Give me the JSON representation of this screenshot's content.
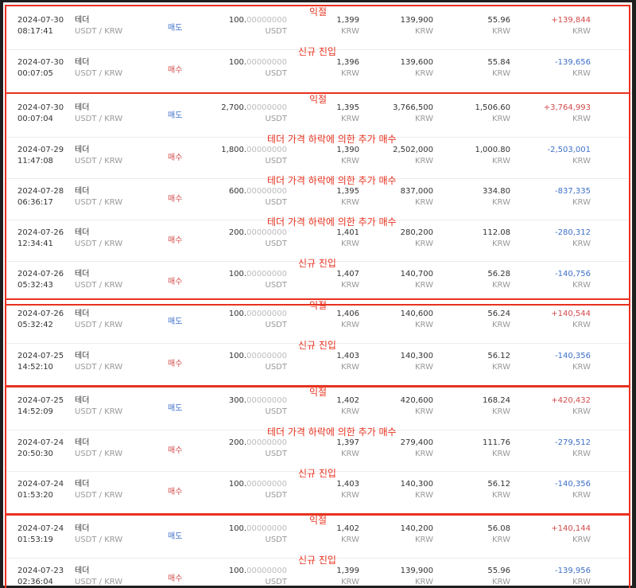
{
  "units": {
    "coin": "USDT",
    "krw": "KRW"
  },
  "colors": {
    "annotation": "#e8321f",
    "sell": "#3d6fc8",
    "buy": "#d24a4a",
    "positive": "#d24a4a",
    "negative": "#3d6fc8"
  },
  "groups": [
    {
      "trades": [
        {
          "date": "2024-07-30",
          "time": "08:17:41",
          "coin": "테더",
          "pair": "USDT / KRW",
          "side": "매도",
          "side_type": "sell",
          "qty_int": "100.",
          "qty_dec": "00000000",
          "price": "1,399",
          "total": "139,900",
          "fee": "55.96",
          "settle": "+139,844",
          "settle_sign": "pos",
          "note": "익절"
        },
        {
          "date": "2024-07-30",
          "time": "00:07:05",
          "coin": "테더",
          "pair": "USDT / KRW",
          "side": "매수",
          "side_type": "buy",
          "qty_int": "100.",
          "qty_dec": "00000000",
          "price": "1,396",
          "total": "139,600",
          "fee": "55.84",
          "settle": "-139,656",
          "settle_sign": "neg",
          "note": "신규 진입"
        }
      ]
    },
    {
      "trades": [
        {
          "date": "2024-07-30",
          "time": "00:07:04",
          "coin": "테더",
          "pair": "USDT / KRW",
          "side": "매도",
          "side_type": "sell",
          "qty_int": "2,700.",
          "qty_dec": "00000000",
          "price": "1,395",
          "total": "3,766,500",
          "fee": "1,506.60",
          "settle": "+3,764,993",
          "settle_sign": "pos",
          "note": "익절"
        },
        {
          "date": "2024-07-29",
          "time": "11:47:08",
          "coin": "테더",
          "pair": "USDT / KRW",
          "side": "매수",
          "side_type": "buy",
          "qty_int": "1,800.",
          "qty_dec": "00000000",
          "price": "1,390",
          "total": "2,502,000",
          "fee": "1,000.80",
          "settle": "-2,503,001",
          "settle_sign": "neg",
          "note": "테더 가격 하락에 의한 추가 매수"
        },
        {
          "date": "2024-07-28",
          "time": "06:36:17",
          "coin": "테더",
          "pair": "USDT / KRW",
          "side": "매수",
          "side_type": "buy",
          "qty_int": "600.",
          "qty_dec": "00000000",
          "price": "1,395",
          "total": "837,000",
          "fee": "334.80",
          "settle": "-837,335",
          "settle_sign": "neg",
          "note": "테더 가격 하락에 의한 추가 매수"
        },
        {
          "date": "2024-07-26",
          "time": "12:34:41",
          "coin": "테더",
          "pair": "USDT / KRW",
          "side": "매수",
          "side_type": "buy",
          "qty_int": "200.",
          "qty_dec": "00000000",
          "price": "1,401",
          "total": "280,200",
          "fee": "112.08",
          "settle": "-280,312",
          "settle_sign": "neg",
          "note": "테더 가격 하락에 의한 추가 매수"
        },
        {
          "date": "2024-07-26",
          "time": "05:32:43",
          "coin": "테더",
          "pair": "USDT / KRW",
          "side": "매수",
          "side_type": "buy",
          "qty_int": "100.",
          "qty_dec": "00000000",
          "price": "1,407",
          "total": "140,700",
          "fee": "56.28",
          "settle": "-140,756",
          "settle_sign": "neg",
          "note": "신규 진입"
        }
      ]
    },
    {
      "trades": [
        {
          "date": "2024-07-26",
          "time": "05:32:42",
          "coin": "테더",
          "pair": "USDT / KRW",
          "side": "매도",
          "side_type": "sell",
          "qty_int": "100.",
          "qty_dec": "00000000",
          "price": "1,406",
          "total": "140,600",
          "fee": "56.24",
          "settle": "+140,544",
          "settle_sign": "pos",
          "note": "익절"
        },
        {
          "date": "2024-07-25",
          "time": "14:52:10",
          "coin": "테더",
          "pair": "USDT / KRW",
          "side": "매수",
          "side_type": "buy",
          "qty_int": "100.",
          "qty_dec": "00000000",
          "price": "1,403",
          "total": "140,300",
          "fee": "56.12",
          "settle": "-140,356",
          "settle_sign": "neg",
          "note": "신규 진입"
        }
      ]
    },
    {
      "trades": [
        {
          "date": "2024-07-25",
          "time": "14:52:09",
          "coin": "테더",
          "pair": "USDT / KRW",
          "side": "매도",
          "side_type": "sell",
          "qty_int": "300.",
          "qty_dec": "00000000",
          "price": "1,402",
          "total": "420,600",
          "fee": "168.24",
          "settle": "+420,432",
          "settle_sign": "pos",
          "note": "익절"
        },
        {
          "date": "2024-07-24",
          "time": "20:50:30",
          "coin": "테더",
          "pair": "USDT / KRW",
          "side": "매수",
          "side_type": "buy",
          "qty_int": "200.",
          "qty_dec": "00000000",
          "price": "1,397",
          "total": "279,400",
          "fee": "111.76",
          "settle": "-279,512",
          "settle_sign": "neg",
          "note": "테더 가격 하락에 의한 추가 매수"
        },
        {
          "date": "2024-07-24",
          "time": "01:53:20",
          "coin": "테더",
          "pair": "USDT / KRW",
          "side": "매수",
          "side_type": "buy",
          "qty_int": "100.",
          "qty_dec": "00000000",
          "price": "1,403",
          "total": "140,300",
          "fee": "56.12",
          "settle": "-140,356",
          "settle_sign": "neg",
          "note": "신규 진입"
        }
      ]
    },
    {
      "trades": [
        {
          "date": "2024-07-24",
          "time": "01:53:19",
          "coin": "테더",
          "pair": "USDT / KRW",
          "side": "매도",
          "side_type": "sell",
          "qty_int": "100.",
          "qty_dec": "00000000",
          "price": "1,402",
          "total": "140,200",
          "fee": "56.08",
          "settle": "+140,144",
          "settle_sign": "pos",
          "note": "익절"
        },
        {
          "date": "2024-07-23",
          "time": "02:36:04",
          "coin": "테더",
          "pair": "USDT / KRW",
          "side": "매수",
          "side_type": "buy",
          "qty_int": "100.",
          "qty_dec": "00000000",
          "price": "1,399",
          "total": "139,900",
          "fee": "55.96",
          "settle": "-139,956",
          "settle_sign": "neg",
          "note": "신규 진입"
        }
      ]
    }
  ]
}
